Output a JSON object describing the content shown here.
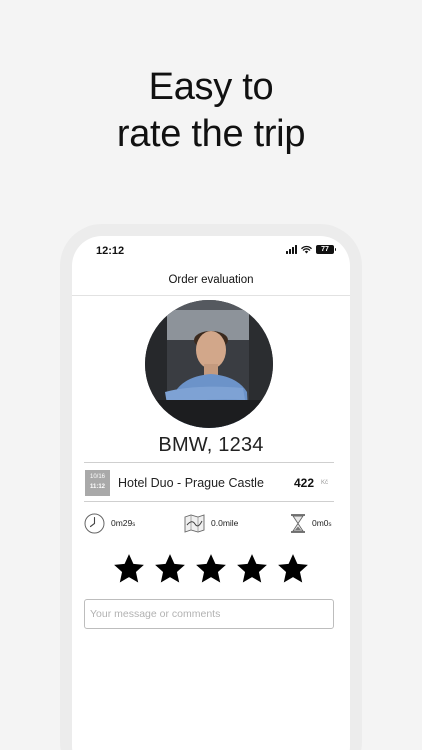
{
  "headline": {
    "line1": "Easy to",
    "line2": "rate the trip"
  },
  "status_bar": {
    "time": "12:12",
    "battery": "77"
  },
  "nav": {
    "title": "Order evaluation"
  },
  "driver": {
    "car": "BMW, 1234"
  },
  "trip": {
    "date": "10/16",
    "time": "11:12",
    "route": "Hotel Duo - Prague Castle",
    "price": "422",
    "currency": "Kč"
  },
  "stats": {
    "duration_main": "0m29",
    "duration_unit": "s",
    "distance": "0.0mile",
    "wait_main": "0m0",
    "wait_unit": "s"
  },
  "rating": {
    "stars_filled": 5,
    "stars_total": 5
  },
  "comment": {
    "placeholder": "Your message or comments",
    "value": ""
  },
  "colors": {
    "star": "#000000",
    "badge": "#a9a9a9",
    "background": "#f4f4f4"
  },
  "icons": {
    "duration": "clock-icon",
    "distance": "map-icon",
    "wait": "hourglass-icon",
    "star": "star-icon",
    "signal": "cellular-signal-icon",
    "wifi": "wifi-icon",
    "battery": "battery-icon"
  }
}
